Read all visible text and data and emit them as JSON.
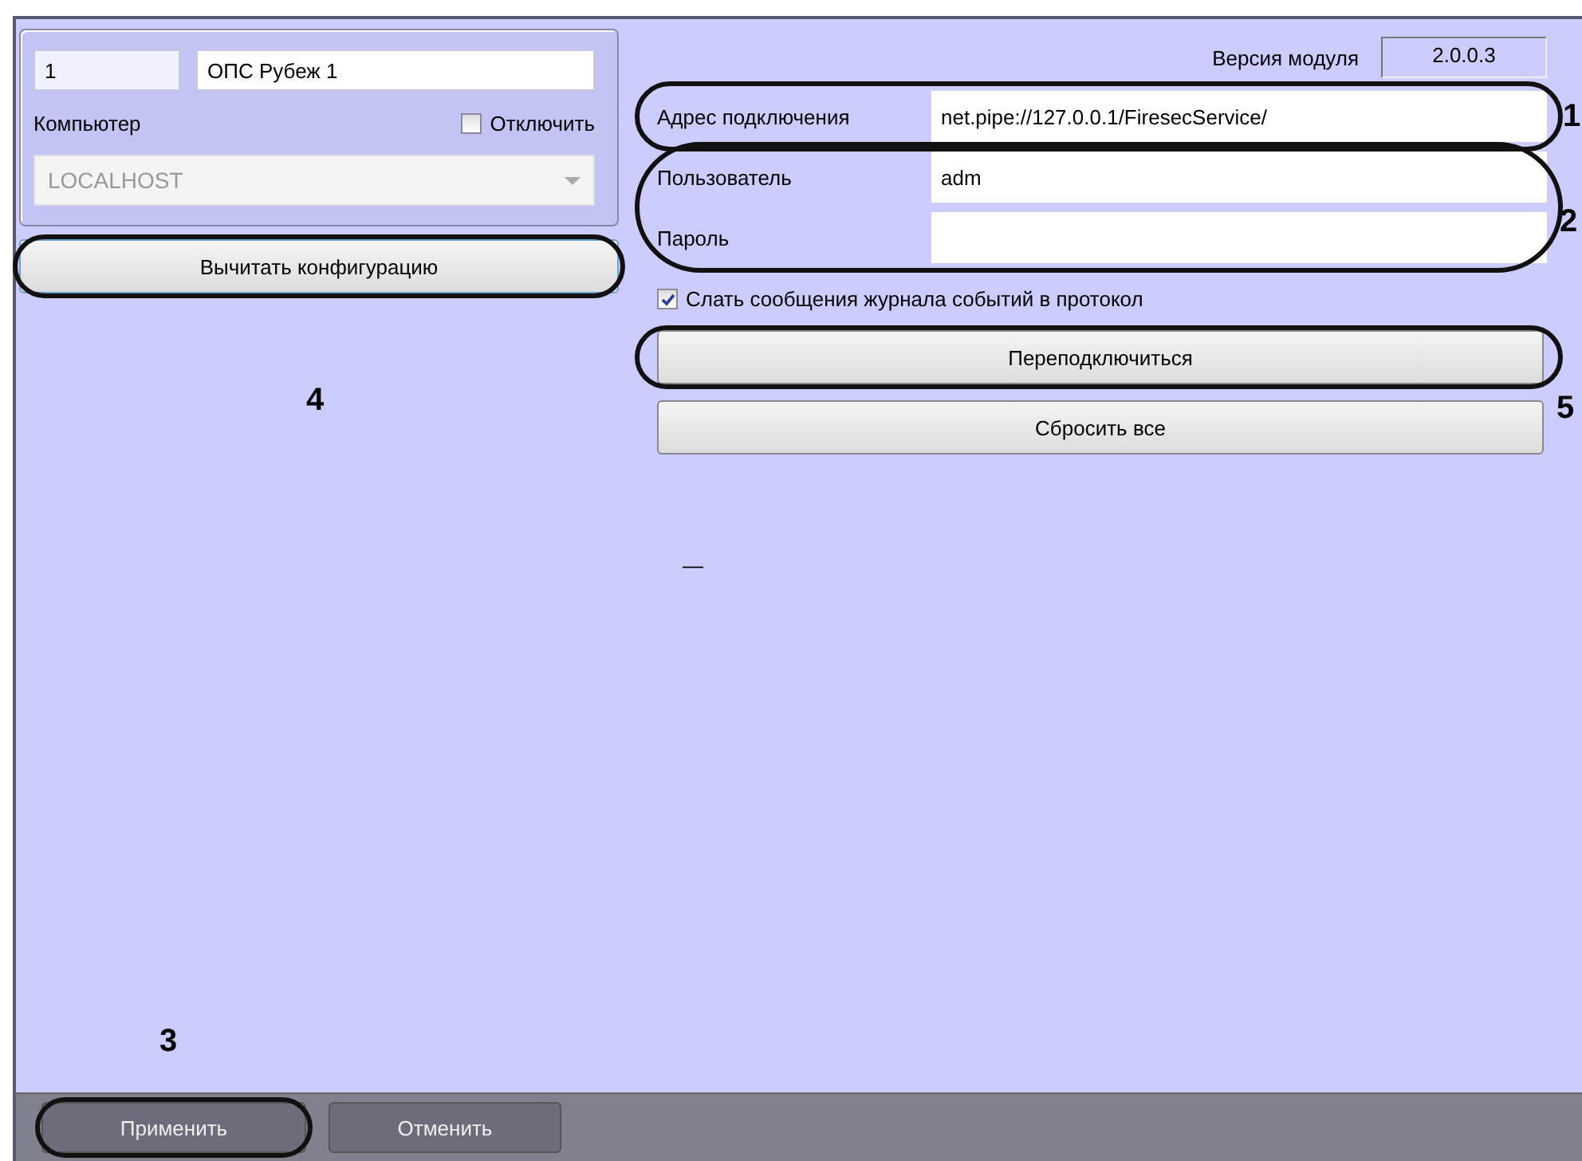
{
  "device": {
    "number": "1",
    "name": "ОПС Рубеж 1",
    "computer_label": "Компьютер",
    "disable": {
      "label": "Отключить",
      "checked": false
    },
    "computer": {
      "value": "LOCALHOST",
      "disabled": true
    }
  },
  "read_button": {
    "label": "Вычитать конфигурацию",
    "callout": "4"
  },
  "module_version": {
    "label": "Версия модуля",
    "value": "2.0.0.3"
  },
  "connection": {
    "address": {
      "label": "Адрес подключения",
      "value": "net.pipe://127.0.0.1/FiresecService/",
      "callout": "1"
    },
    "credentials": {
      "callout": "2",
      "user": {
        "label": "Пользователь",
        "value": "adm"
      },
      "password": {
        "label": "Пароль"
      }
    }
  },
  "log_checkbox": {
    "label": "Слать сообщения журнала событий в протокол",
    "checked": true
  },
  "reconnect_button": {
    "label": "Переподключиться",
    "callout": "5"
  },
  "reset_button": {
    "label": "Сбросить все"
  },
  "dash": "—",
  "footer": {
    "buttons": [
      {
        "label": "Применить",
        "kind": "apply",
        "callout": "3"
      },
      {
        "label": "Отменить",
        "kind": "cancel"
      }
    ]
  }
}
